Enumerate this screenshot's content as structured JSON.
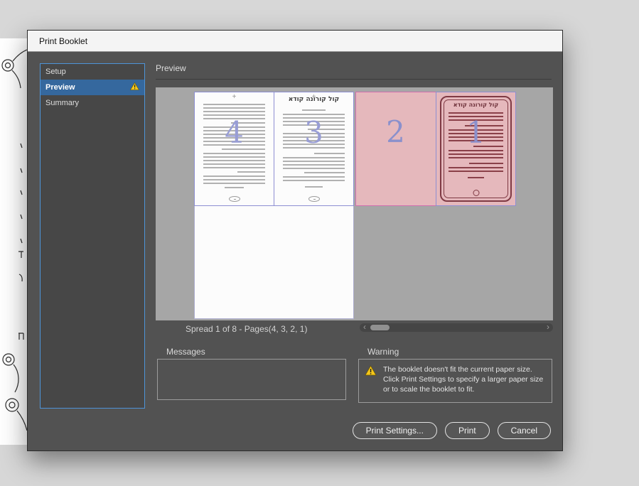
{
  "window": {
    "title": "Print Booklet"
  },
  "sidebar": {
    "items": [
      {
        "label": "Setup",
        "selected": false,
        "warning": false
      },
      {
        "label": "Preview",
        "selected": true,
        "warning": true
      },
      {
        "label": "Summary",
        "selected": false,
        "warning": false
      }
    ]
  },
  "preview": {
    "heading": "Preview",
    "spread_label": "Spread 1 of 8 - Pages(4, 3, 2, 1)",
    "pages": [
      {
        "number": "4"
      },
      {
        "number": "3",
        "running_head": "קול קורונה קודא"
      },
      {
        "number": "2"
      },
      {
        "number": "1",
        "running_head": "קול קורונה קודא"
      }
    ],
    "crop_mark": "+",
    "scrollbar": {
      "left_arrow": "‹",
      "right_arrow": "›"
    }
  },
  "messages": {
    "label": "Messages"
  },
  "warning": {
    "label": "Warning",
    "text": "The booklet doesn't fit the current paper size. Click Print Settings to specify a larger paper size or to scale the booklet to fit."
  },
  "buttons": [
    {
      "label": "Print Settings..."
    },
    {
      "label": "Print"
    },
    {
      "label": "Cancel"
    }
  ],
  "colors": {
    "selection_blue": "#35689e",
    "sidebar_focus_blue": "#4e94d8",
    "warning_yellow": "#f5c71a",
    "page_pink": "#e5b8bc",
    "cover_red": "#7f3a44",
    "page_number_purple": "#989dd5",
    "guide_purple": "#8d8fd2",
    "guide_magenta": "#cf6fae"
  }
}
